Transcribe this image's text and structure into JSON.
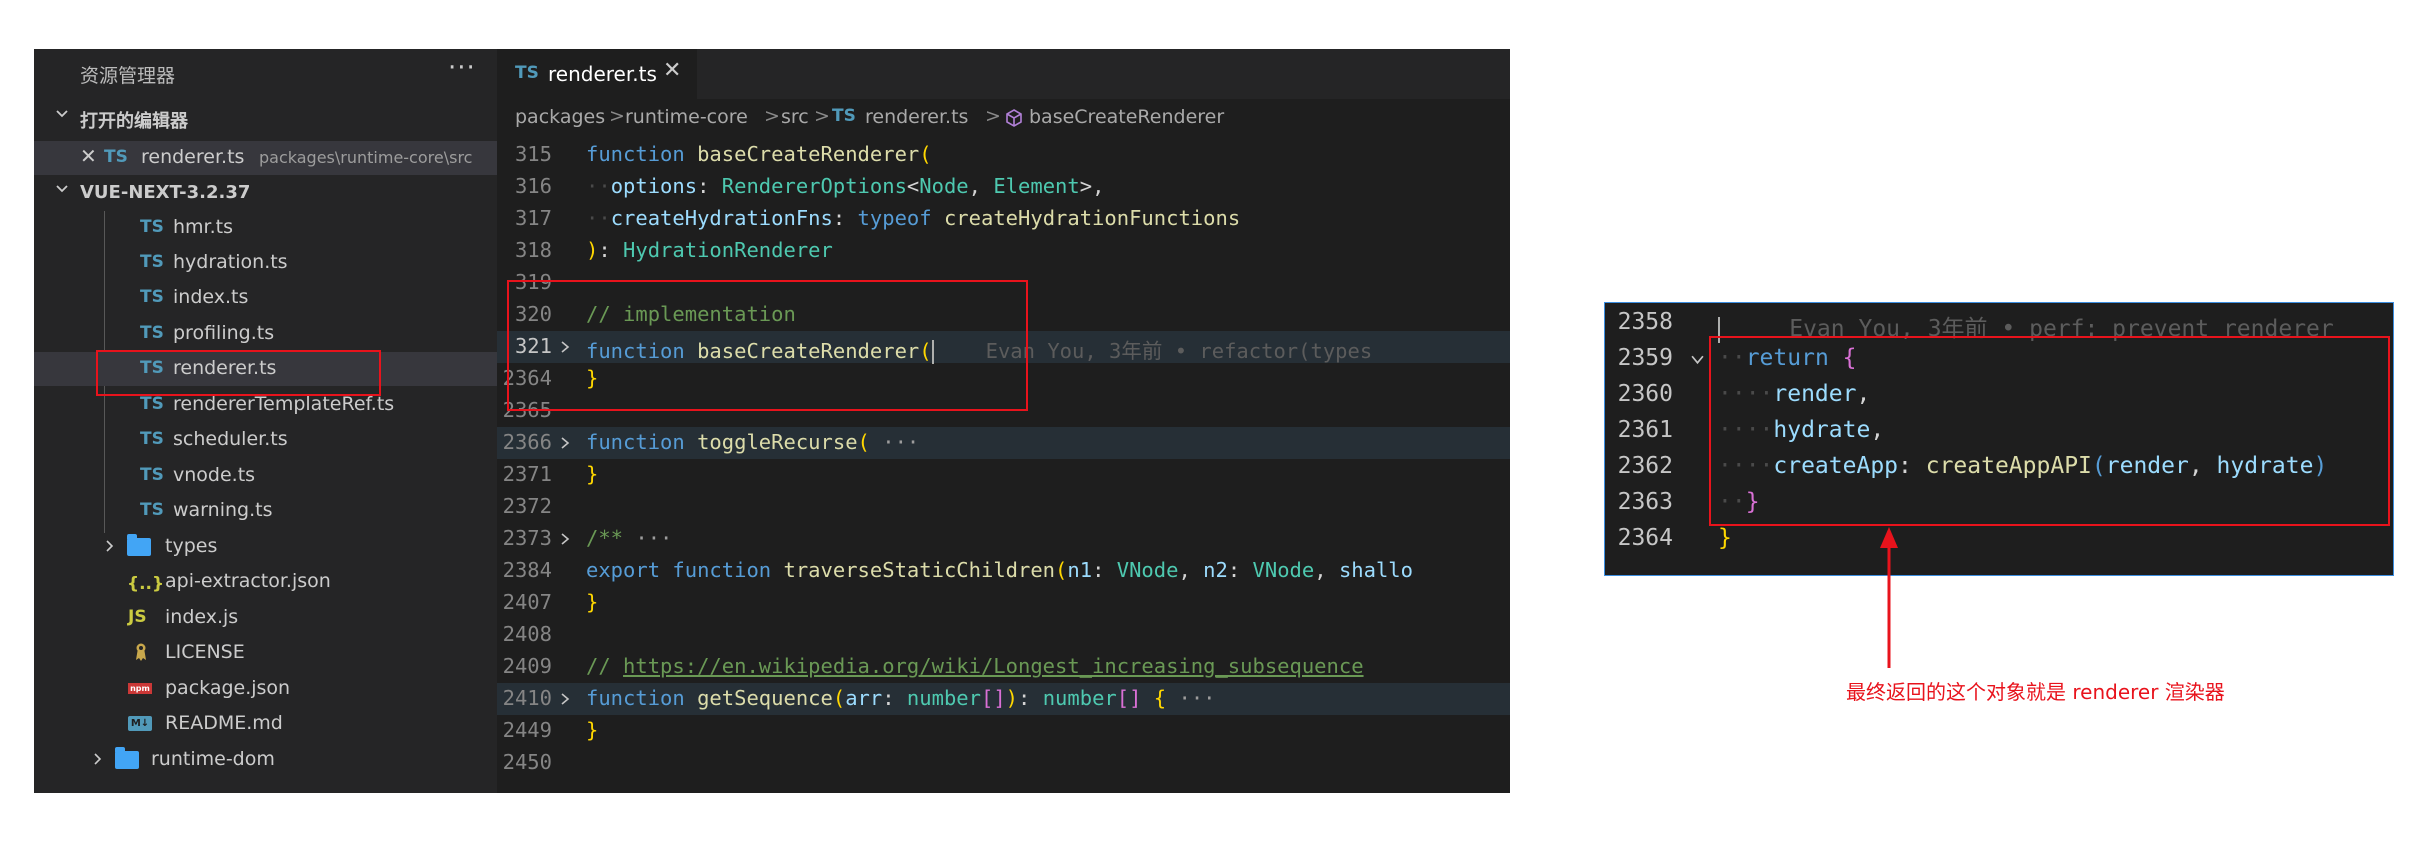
{
  "explorer": {
    "title": "资源管理器",
    "more": "···",
    "open_editors_label": "打开的编辑器",
    "open_editor": {
      "close": "✕",
      "icon": "TS",
      "name": "renderer.ts",
      "path": "packages\\runtime-core\\src"
    },
    "project_label": "VUE-NEXT-3.2.37",
    "files": [
      {
        "icon": "TS",
        "name": "hmr.ts"
      },
      {
        "icon": "TS",
        "name": "hydration.ts"
      },
      {
        "icon": "TS",
        "name": "index.ts"
      },
      {
        "icon": "TS",
        "name": "profiling.ts"
      },
      {
        "icon": "TS",
        "name": "renderer.ts",
        "selected": true
      },
      {
        "icon": "TS",
        "name": "rendererTemplateRef.ts"
      },
      {
        "icon": "TS",
        "name": "scheduler.ts"
      },
      {
        "icon": "TS",
        "name": "vnode.ts"
      },
      {
        "icon": "TS",
        "name": "warning.ts"
      }
    ],
    "types_folder": "types",
    "json_icon": "{..}",
    "json_file": "api-extractor.json",
    "js_icon": "JS",
    "js_file": "index.js",
    "license_file": "LICENSE",
    "npm_icon": "npm",
    "package_file": "package.json",
    "md_icon": "M↓",
    "readme_file": "README.md",
    "runtime_dom_folder": "runtime-dom"
  },
  "tab": {
    "icon": "TS",
    "name": "renderer.ts",
    "close": "✕"
  },
  "breadcrumb": [
    "packages",
    "runtime-core",
    "src",
    "renderer.ts",
    "baseCreateRenderer"
  ],
  "breadcrumb_separator": ">",
  "breadcrumb_file_icon": "TS",
  "code_lines": [
    {
      "n": "315",
      "tokens": [
        [
          "kw",
          "function"
        ],
        [
          "pu",
          " "
        ],
        [
          "fn",
          "baseCreateRenderer"
        ],
        [
          "br",
          "("
        ]
      ]
    },
    {
      "n": "316",
      "tokens": [
        [
          "dots",
          "··"
        ],
        [
          "pm",
          "options"
        ],
        [
          "pu",
          ": "
        ],
        [
          "ty",
          "RendererOptions"
        ],
        [
          "pu",
          "<"
        ],
        [
          "ty",
          "Node"
        ],
        [
          "pu",
          ", "
        ],
        [
          "ty",
          "Element"
        ],
        [
          "pu",
          ">,"
        ]
      ]
    },
    {
      "n": "317",
      "tokens": [
        [
          "dots",
          "··"
        ],
        [
          "pm",
          "createHydrationFns"
        ],
        [
          "pu",
          ": "
        ],
        [
          "kw",
          "typeof"
        ],
        [
          "pu",
          " "
        ],
        [
          "fn",
          "createHydrationFunctions"
        ]
      ]
    },
    {
      "n": "318",
      "tokens": [
        [
          "br",
          ")"
        ],
        [
          "pu",
          ": "
        ],
        [
          "ty",
          "HydrationRenderer"
        ]
      ]
    },
    {
      "n": "319",
      "tokens": []
    },
    {
      "n": "320",
      "tokens": [
        [
          "cm",
          "// implementation"
        ]
      ]
    },
    {
      "n": "321",
      "fold": true,
      "current": true,
      "highlight": true,
      "cursor": true,
      "tokens": [
        [
          "kw",
          "function"
        ],
        [
          "pu",
          " "
        ],
        [
          "fn",
          "baseCreateRenderer"
        ],
        [
          "br",
          "("
        ]
      ],
      "blame": "Evan You, 3年前 • refactor(types"
    },
    {
      "n": "2364",
      "tokens": [
        [
          "br",
          "}"
        ]
      ]
    },
    {
      "n": "2365",
      "tokens": []
    },
    {
      "n": "2366",
      "fold": true,
      "highlight": true,
      "tokens": [
        [
          "kw",
          "function"
        ],
        [
          "pu",
          " "
        ],
        [
          "fn",
          "toggleRecurse"
        ],
        [
          "br",
          "("
        ],
        [
          "ellip",
          " ···"
        ]
      ]
    },
    {
      "n": "2371",
      "tokens": [
        [
          "br",
          "}"
        ]
      ]
    },
    {
      "n": "2372",
      "tokens": []
    },
    {
      "n": "2373",
      "fold": true,
      "tokens": [
        [
          "cm",
          "/**"
        ],
        [
          "ellip",
          " ···"
        ]
      ]
    },
    {
      "n": "2384",
      "tokens": [
        [
          "kw",
          "export"
        ],
        [
          "pu",
          " "
        ],
        [
          "kw",
          "function"
        ],
        [
          "pu",
          " "
        ],
        [
          "fn",
          "traverseStaticChildren"
        ],
        [
          "br",
          "("
        ],
        [
          "pm",
          "n1"
        ],
        [
          "pu",
          ": "
        ],
        [
          "ty",
          "VNode"
        ],
        [
          "pu",
          ", "
        ],
        [
          "pm",
          "n2"
        ],
        [
          "pu",
          ": "
        ],
        [
          "ty",
          "VNode"
        ],
        [
          "pu",
          ", "
        ],
        [
          "pm",
          "shallo"
        ]
      ]
    },
    {
      "n": "2407",
      "tokens": [
        [
          "br",
          "}"
        ]
      ]
    },
    {
      "n": "2408",
      "tokens": []
    },
    {
      "n": "2409",
      "tokens": [
        [
          "cm",
          "// "
        ],
        [
          "link",
          "https://en.wikipedia.org/wiki/Longest_increasing_subsequence"
        ]
      ]
    },
    {
      "n": "2410",
      "fold": true,
      "highlight": true,
      "tokens": [
        [
          "kw",
          "function"
        ],
        [
          "pu",
          " "
        ],
        [
          "fn",
          "getSequence"
        ],
        [
          "br",
          "("
        ],
        [
          "pm",
          "arr"
        ],
        [
          "pu",
          ": "
        ],
        [
          "ty",
          "number"
        ],
        [
          "br2",
          "[]"
        ],
        [
          "br",
          ")"
        ],
        [
          "pu",
          ": "
        ],
        [
          "ty",
          "number"
        ],
        [
          "br2",
          "[]"
        ],
        [
          "pu",
          " "
        ],
        [
          "br",
          "{"
        ],
        [
          "ellip",
          " ···"
        ]
      ]
    },
    {
      "n": "2449",
      "tokens": [
        [
          "br",
          "}"
        ]
      ]
    },
    {
      "n": "2450",
      "tokens": []
    }
  ],
  "zoom_lines": [
    {
      "n": "2358",
      "cursor": true,
      "tokens": [
        [
          "blame",
          "     Evan You, 3年前 • perf: prevent renderer"
        ]
      ]
    },
    {
      "n": "2359",
      "fold": true,
      "tokens": [
        [
          "dots",
          "··"
        ],
        [
          "kw",
          "return"
        ],
        [
          "pu",
          " "
        ],
        [
          "br2",
          "{"
        ]
      ]
    },
    {
      "n": "2360",
      "tokens": [
        [
          "dots",
          "····"
        ],
        [
          "pm",
          "render"
        ],
        [
          "pu",
          ","
        ]
      ]
    },
    {
      "n": "2361",
      "tokens": [
        [
          "dots",
          "····"
        ],
        [
          "pm",
          "hydrate"
        ],
        [
          "pu",
          ","
        ]
      ]
    },
    {
      "n": "2362",
      "tokens": [
        [
          "dots",
          "····"
        ],
        [
          "pm",
          "createApp"
        ],
        [
          "pu",
          ": "
        ],
        [
          "fn",
          "createAppAPI"
        ],
        [
          "kw",
          "("
        ],
        [
          "pm",
          "render"
        ],
        [
          "pu",
          ", "
        ],
        [
          "pm",
          "hydrate"
        ],
        [
          "kw",
          ")"
        ]
      ]
    },
    {
      "n": "2363",
      "tokens": [
        [
          "dots",
          "··"
        ],
        [
          "br2",
          "}"
        ]
      ]
    },
    {
      "n": "2364",
      "tokens": [
        [
          "br",
          "}"
        ]
      ]
    }
  ],
  "annotation": "最终返回的这个对象就是 renderer 渲染器",
  "colors": {
    "accent_red": "#e8131c",
    "ts_blue": "#519aba",
    "editor_bg": "#1e1e1e",
    "sidebar_bg": "#252526"
  }
}
